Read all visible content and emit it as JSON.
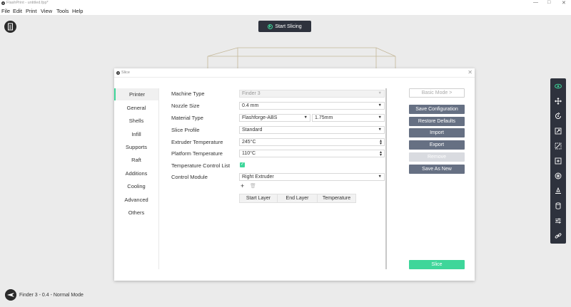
{
  "window": {
    "title": "FlashPrint - untitled.fpp*",
    "controls": [
      "—",
      "□",
      "✕"
    ]
  },
  "menu": [
    "File",
    "Edit",
    "Print",
    "View",
    "Tools",
    "Help"
  ],
  "canvas": {
    "start_slicing_label": "Start Slicing",
    "status_text": "Finder 3 - 0.4 - Normal Mode"
  },
  "colors": {
    "accent": "#3ed69a",
    "toolbar": "#2e323d",
    "button": "#667083"
  },
  "toolbar_icons": [
    "eye-icon",
    "move-icon",
    "rotate-icon",
    "scale-icon",
    "cut-icon",
    "add-icon",
    "supports-icon",
    "lay-flat-icon",
    "cylinder-icon",
    "settings-sliders-icon",
    "link-icon"
  ],
  "dialog": {
    "title": "Slice",
    "sidebar": [
      "Printer",
      "General",
      "Shells",
      "Infill",
      "Supports",
      "Raft",
      "Additions",
      "Cooling",
      "Advanced",
      "Others"
    ],
    "active_tab": "Printer",
    "fields": {
      "machine_type": {
        "label": "Machine Type",
        "value": "Finder 3"
      },
      "nozzle_size": {
        "label": "Nozzle Size",
        "value": "0.4 mm"
      },
      "material_type": {
        "label": "Material Type",
        "value": "Flashforge-ABS",
        "diameter": "1.75mm"
      },
      "slice_profile": {
        "label": "Slice Profile",
        "value": "Standard"
      },
      "extruder_temp": {
        "label": "Extruder Temperature",
        "value": "245°C"
      },
      "platform_temp": {
        "label": "Platform Temperature",
        "value": "110°C"
      },
      "temp_control_list": {
        "label": "Temperature Control List",
        "checked": true
      },
      "control_module": {
        "label": "Control Module",
        "value": "Right Extruder"
      }
    },
    "table_headers": [
      "Start Layer",
      "End Layer",
      "Temperature"
    ],
    "buttons": {
      "basic_mode": "Basic Mode >",
      "save_config": "Save Configuration",
      "restore_defaults": "Restore Defaults",
      "import": "Import",
      "export": "Export",
      "remove": "Remove",
      "save_as_new": "Save As New",
      "slice": "Slice"
    }
  }
}
